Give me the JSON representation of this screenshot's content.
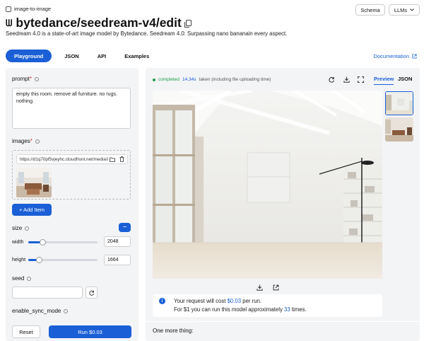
{
  "header": {
    "category_tag": "image-to-image",
    "schema_label": "Schema",
    "llms_label": "LLMs",
    "logo_text": "ᗯ",
    "model_name": "bytedance/seedream-v4/edit",
    "description": "Seedream 4.0 is a state-of-art image model by Bytedance. Seedream 4.0: Surpassing nano bananain every aspect."
  },
  "tabs": [
    {
      "label": "Playground",
      "active": true
    },
    {
      "label": "JSON",
      "active": false
    },
    {
      "label": "API",
      "active": false
    },
    {
      "label": "Examples",
      "active": false
    }
  ],
  "documentation_label": "Documentation",
  "form": {
    "prompt_label": "prompt",
    "prompt_required": "*",
    "prompt_value": "empty this room. remove all furniture. no rugs. nothing.",
    "images_label": "images",
    "images_required": "*",
    "image_url": "https://d1q70pf5vjeyhc.cloudfront.net/media/i",
    "add_item_label": "+ Add Item",
    "size_label": "size",
    "size_collapse": "−",
    "width_label": "width",
    "width_value": "2048",
    "width_fraction": 0.2,
    "height_label": "height",
    "height_value": "1664",
    "height_fraction": 0.15,
    "seed_label": "seed",
    "seed_value": "",
    "sync_label": "enable_sync_mode",
    "reset_label": "Reset",
    "run_label": "Run $0.03"
  },
  "output": {
    "status": "completed",
    "time": "14.34s",
    "time_note": "taken (including file uploading time)",
    "preview_tab": "Preview",
    "json_tab": "JSON",
    "cost_line1_pre": "Your request will cost ",
    "cost_value": "$0.03",
    "cost_line1_post": " per run.",
    "cost_line2_pre": "For $1 you can run this model approximately ",
    "runs_value": "33",
    "cost_line2_post": " times.",
    "one_more": "One more thing:"
  },
  "colors": {
    "accent": "#1a5fd6",
    "success": "#22a04b",
    "panel": "#f3f4f6"
  },
  "icons": [
    "copy-icon",
    "info-icon",
    "folder-icon",
    "trash-icon",
    "refresh-icon",
    "download-icon",
    "expand-icon",
    "external-link-icon",
    "chevron-down-icon"
  ]
}
